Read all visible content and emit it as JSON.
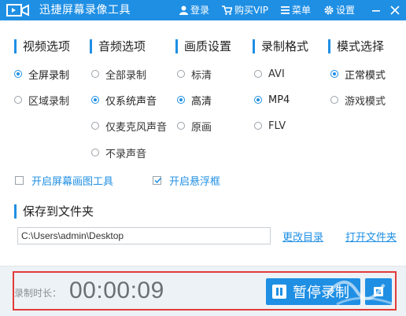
{
  "titlebar": {
    "app_title": "迅捷屏幕录像工具",
    "login": "登录",
    "buy_vip": "购买VIP",
    "menu": "菜单",
    "settings": "设置"
  },
  "sections": {
    "video": {
      "title": "视频选项",
      "options": [
        "全屏录制",
        "区域录制"
      ],
      "selected": "全屏录制"
    },
    "audio": {
      "title": "音频选项",
      "options": [
        "全部录制",
        "仅系统声音",
        "仅麦克风声音",
        "不录声音"
      ],
      "selected": "仅系统声音"
    },
    "quality": {
      "title": "画质设置",
      "options": [
        "标清",
        "高清",
        "原画"
      ],
      "selected": "高清"
    },
    "format": {
      "title": "录制格式",
      "options": [
        "AVI",
        "MP4",
        "FLV"
      ],
      "selected": "MP4"
    },
    "mode": {
      "title": "模式选择",
      "options": [
        "正常模式",
        "游戏模式"
      ],
      "selected": "正常模式"
    }
  },
  "checkboxes": {
    "drawing_tool": {
      "label": "开启屏幕画图工具",
      "checked": false
    },
    "float_window": {
      "label": "开启悬浮框",
      "checked": true
    }
  },
  "save": {
    "title": "保存到文件夹",
    "path": "C:\\Users\\admin\\Desktop",
    "change_dir": "更改目录",
    "open_folder": "打开文件夹"
  },
  "recording": {
    "duration_label": "录制时长：",
    "duration_value": "00:00:09",
    "pause_label": "暂停录制"
  },
  "colors": {
    "accent": "#1f8fe4",
    "highlight": "#e23b3b"
  }
}
